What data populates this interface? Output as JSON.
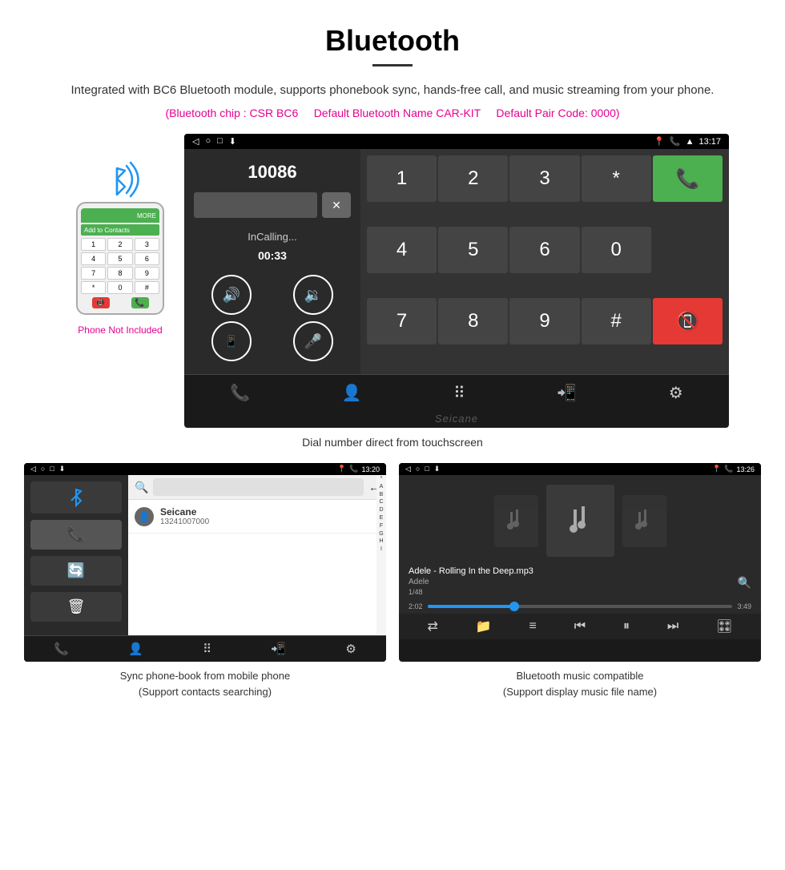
{
  "page": {
    "title": "Bluetooth",
    "subtitle": "Integrated with BC6 Bluetooth module, supports phonebook sync, hands-free call, and music streaming from your phone.",
    "spec_line": "(Bluetooth chip : CSR BC6    Default Bluetooth Name CAR-KIT    Default Pair Code: 0000)",
    "spec_chip": "(Bluetooth chip : CSR BC6",
    "spec_name": "Default Bluetooth Name CAR-KIT",
    "spec_code": "Default Pair Code: 0000)",
    "phone_not_included": "Phone Not Included",
    "main_caption": "Dial number direct from touchscreen",
    "left_caption_line1": "Sync phone-book from mobile phone",
    "left_caption_line2": "(Support contacts searching)",
    "right_caption_line1": "Bluetooth music compatible",
    "right_caption_line2": "(Support display music file name)"
  },
  "dial_screen": {
    "status_time": "13:17",
    "call_number": "10086",
    "call_status": "InCalling...",
    "call_duration": "00:33",
    "keys": [
      "1",
      "2",
      "3",
      "*",
      "4",
      "5",
      "6",
      "0",
      "7",
      "8",
      "9",
      "#"
    ],
    "call_btn": "📞",
    "end_btn": "📵"
  },
  "phonebook_screen": {
    "status_time": "13:20",
    "contact_name": "Seicane",
    "contact_number": "13241007000",
    "alpha_list": [
      "*",
      "A",
      "B",
      "C",
      "D",
      "E",
      "F",
      "G",
      "H",
      "I"
    ]
  },
  "music_screen": {
    "status_time": "13:26",
    "track_title": "Adele - Rolling In the Deep.mp3",
    "artist": "Adele",
    "track_count": "1/48",
    "time_current": "2:02",
    "time_total": "3:49",
    "progress_percent": 30
  }
}
